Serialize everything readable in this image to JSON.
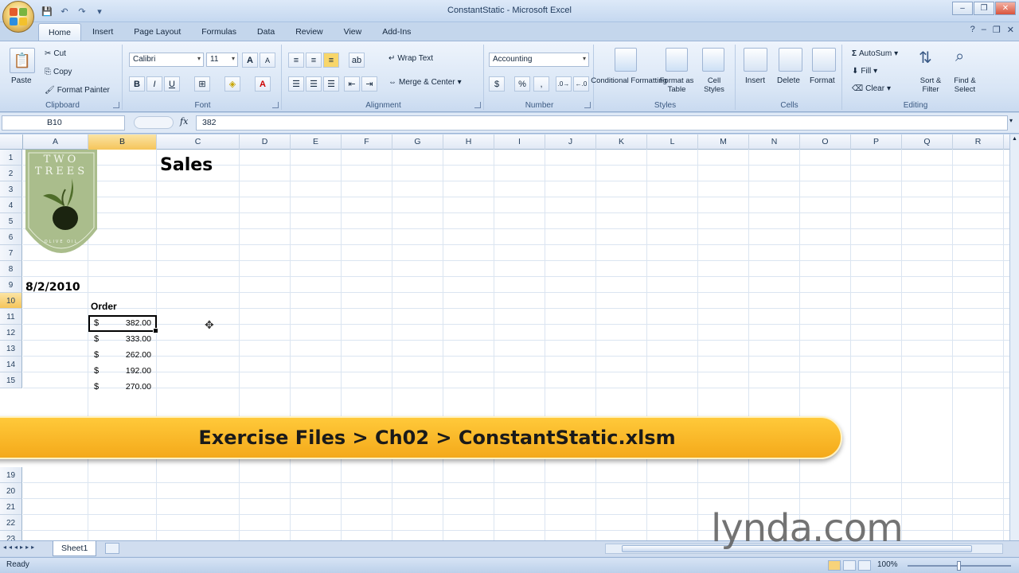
{
  "window": {
    "title": "ConstantStatic - Microsoft Excel",
    "minimize": "–",
    "restore": "❐",
    "close": "✕"
  },
  "ribbon": {
    "tabs": [
      "Home",
      "Insert",
      "Page Layout",
      "Formulas",
      "Data",
      "Review",
      "View",
      "Add-Ins"
    ],
    "clipboard": {
      "label": "Clipboard",
      "paste": "Paste",
      "cut": "Cut",
      "copy": "Copy",
      "format_painter": "Format Painter"
    },
    "font": {
      "label": "Font",
      "name": "Calibri",
      "size": "11",
      "grow": "A",
      "shrink": "A",
      "bold": "B",
      "italic": "I",
      "underline": "U"
    },
    "alignment": {
      "label": "Alignment",
      "wrap_text": "Wrap Text",
      "merge_center": "Merge & Center"
    },
    "number": {
      "label": "Number",
      "format": "Accounting",
      "currency": "$",
      "percent": "%",
      "comma": ","
    },
    "styles": {
      "label": "Styles",
      "conditional": "Conditional Formatting",
      "format_table": "Format as Table",
      "cell_styles": "Cell Styles"
    },
    "cells": {
      "label": "Cells",
      "insert": "Insert",
      "delete": "Delete",
      "format": "Format"
    },
    "editing": {
      "label": "Editing",
      "autosum": "AutoSum",
      "fill": "Fill",
      "clear": "Clear",
      "sort_filter": "Sort & Filter",
      "find_select": "Find & Select"
    }
  },
  "formula_bar": {
    "name_box": "B10",
    "fx": "fx",
    "value": "382"
  },
  "grid": {
    "columns": [
      "A",
      "B",
      "C",
      "D",
      "E",
      "F",
      "G",
      "H",
      "I",
      "J",
      "K",
      "L",
      "M",
      "N",
      "O",
      "P",
      "Q",
      "R"
    ],
    "rows": [
      "1",
      "2",
      "3",
      "4",
      "5",
      "6",
      "7",
      "8",
      "9",
      "10",
      "11",
      "12",
      "13",
      "14",
      "15",
      "19",
      "20",
      "21",
      "22",
      "23"
    ],
    "title": "Sales",
    "date": "8/2/2010",
    "order_header": "Order",
    "orders": [
      {
        "currency": "$",
        "amount": "382.00"
      },
      {
        "currency": "$",
        "amount": "333.00"
      },
      {
        "currency": "$",
        "amount": "262.00"
      },
      {
        "currency": "$",
        "amount": "192.00"
      },
      {
        "currency": "$",
        "amount": "270.00"
      }
    ],
    "logo_text": "TWO TREES",
    "logo_bottom": "OLIVE OIL"
  },
  "sheet_tabs": [
    "Sheet1"
  ],
  "status": {
    "ready": "Ready",
    "zoom": "100%"
  },
  "banner": "Exercise Files > Ch02 > ConstantStatic.xlsm",
  "watermark": "lynda.com",
  "colors": {
    "selected_header": "#f5c55a",
    "banner": "#f7b21f",
    "ribbon": "#dbe7f6"
  }
}
